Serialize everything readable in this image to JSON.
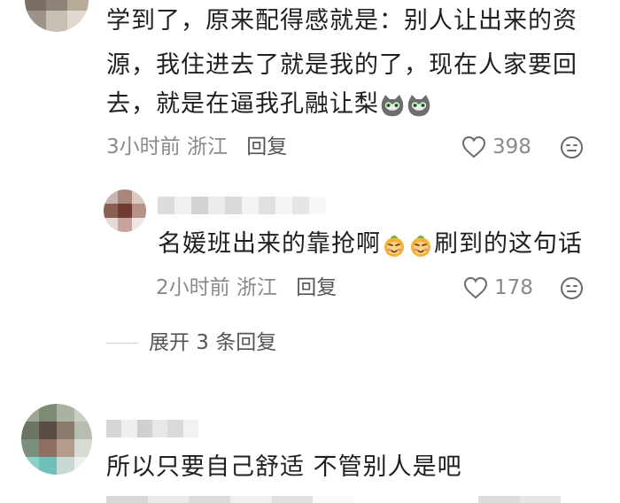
{
  "colors": {
    "text": "#1f1f1f",
    "meta": "#8a8a8a",
    "reply": "#555555"
  },
  "comments": [
    {
      "lines": [
        "学到了，原来配得感就是：别人让出来的资",
        "源，我住进去了就是我的了，现在人家要回",
        "去，就是在逼我孔融让梨"
      ],
      "emojis": [
        "cat-face-emoji",
        "cat-face-emoji"
      ],
      "time": "3小时前",
      "location": "浙江",
      "reply_label": "回复",
      "likes": "398"
    },
    {
      "text_before": "名媛班出来的靠抢啊",
      "emojis": [
        "smug-face-emoji",
        "smug-face-emoji"
      ],
      "text_after": "刷到的这句话",
      "time": "2小时前",
      "location": "浙江",
      "reply_label": "回复",
      "likes": "178"
    },
    {
      "text": "所以只要自己舒适 不管别人是吧"
    }
  ],
  "expand_replies": "展开 3 条回复"
}
